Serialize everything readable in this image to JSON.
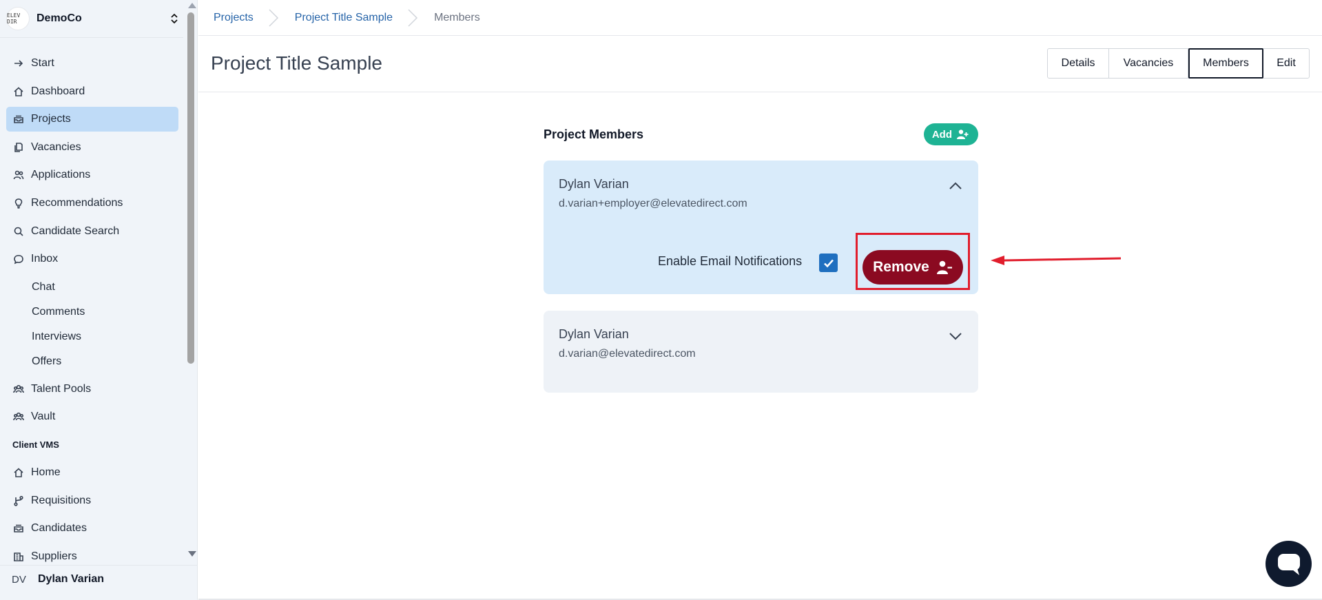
{
  "org": {
    "name": "DemoCo",
    "logo_text": "ELEV DIR"
  },
  "sidebar": {
    "items": [
      {
        "label": "Start",
        "icon": "arrow-right-icon"
      },
      {
        "label": "Dashboard",
        "icon": "home-icon"
      },
      {
        "label": "Projects",
        "icon": "inbox-stack-icon",
        "active": true
      },
      {
        "label": "Vacancies",
        "icon": "documents-icon"
      },
      {
        "label": "Applications",
        "icon": "users-icon"
      },
      {
        "label": "Recommendations",
        "icon": "lightbulb-icon"
      },
      {
        "label": "Candidate Search",
        "icon": "search-icon"
      },
      {
        "label": "Inbox",
        "icon": "chat-bubble-icon"
      }
    ],
    "inbox_sub": [
      "Chat",
      "Comments",
      "Interviews",
      "Offers"
    ],
    "items2": [
      {
        "label": "Talent Pools",
        "icon": "user-group-icon"
      },
      {
        "label": "Vault",
        "icon": "user-group-icon"
      }
    ],
    "section_label": "Client VMS",
    "items3": [
      {
        "label": "Home",
        "icon": "home-icon"
      },
      {
        "label": "Requisitions",
        "icon": "branch-icon"
      },
      {
        "label": "Candidates",
        "icon": "inbox-stack-icon"
      },
      {
        "label": "Suppliers",
        "icon": "building-icon"
      }
    ]
  },
  "user": {
    "initials": "DV",
    "name": "Dylan Varian"
  },
  "breadcrumb": [
    "Projects",
    "Project Title Sample",
    "Members"
  ],
  "page": {
    "title": "Project Title Sample",
    "tabs": [
      "Details",
      "Vacancies",
      "Members",
      "Edit"
    ],
    "active_tab": "Members"
  },
  "members": {
    "title": "Project Members",
    "add_label": "Add",
    "list": [
      {
        "name": "Dylan Varian",
        "email": "d.varian+employer@elevatedirect.com",
        "expanded": true,
        "notifications_label": "Enable Email Notifications",
        "notifications_enabled": true,
        "remove_label": "Remove"
      },
      {
        "name": "Dylan Varian",
        "email": "d.varian@elevatedirect.com",
        "expanded": false
      }
    ]
  },
  "colors": {
    "accent_blue": "#2563a8",
    "add_green": "#1eb394",
    "remove_red": "#8b0a21",
    "annotation_red": "#e11d2c",
    "active_nav": "#bfdbf7"
  }
}
